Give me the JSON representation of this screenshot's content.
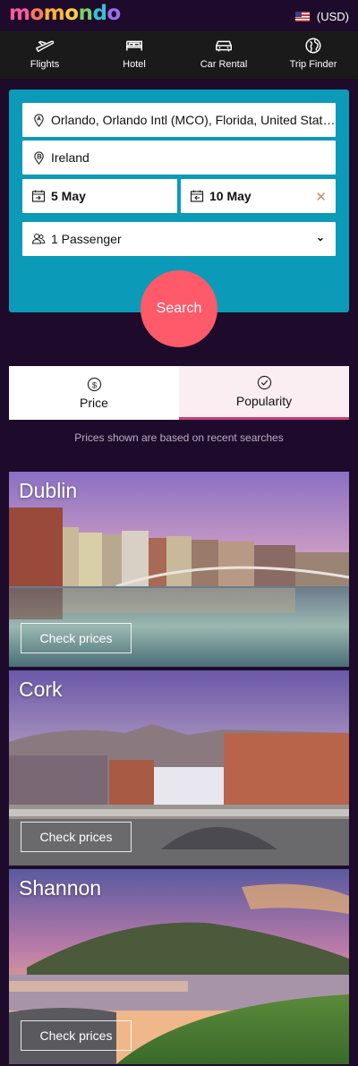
{
  "header": {
    "logo": [
      "m",
      "o",
      "m",
      "o",
      "n",
      "d",
      "o"
    ],
    "logo_colors": [
      "#ff5aa0",
      "#ff7a5a",
      "#ffb23e",
      "#f4d23c",
      "#7ad36a",
      "#38c0d8",
      "#9a6ef0"
    ],
    "currency": "(USD)"
  },
  "nav": [
    {
      "label": "Flights",
      "icon": "plane-icon"
    },
    {
      "label": "Hotel",
      "icon": "bed-icon"
    },
    {
      "label": "Car Rental",
      "icon": "car-icon"
    },
    {
      "label": "Trip Finder",
      "icon": "globe-icon"
    }
  ],
  "search": {
    "origin": "Orlando, Orlando Intl (MCO), Florida, United States",
    "destination": "Ireland",
    "depart_date": "5 May",
    "return_date": "10 May",
    "passengers": "1 Passenger",
    "button": "Search"
  },
  "sort": {
    "price_label": "Price",
    "popularity_label": "Popularity",
    "note": "Prices shown are based on recent searches"
  },
  "destinations": [
    {
      "city": "Dublin",
      "button": "Check prices"
    },
    {
      "city": "Cork",
      "button": "Check prices"
    },
    {
      "city": "Shannon",
      "button": "Check prices"
    }
  ]
}
